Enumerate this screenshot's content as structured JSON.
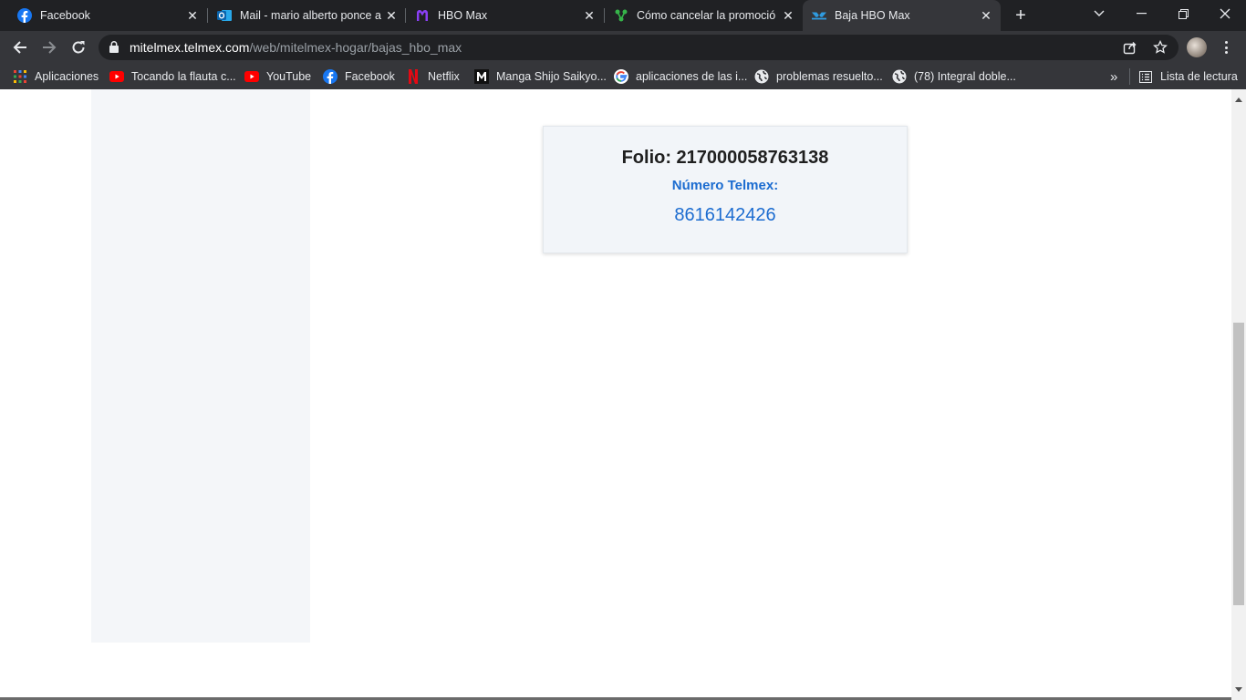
{
  "browser": {
    "tabs": [
      {
        "title": "Facebook",
        "icon": "facebook-icon"
      },
      {
        "title": "Mail - mario alberto ponce a",
        "icon": "outlook-icon"
      },
      {
        "title": "HBO Max",
        "icon": "hbomax-icon"
      },
      {
        "title": "Cómo cancelar la promoción",
        "icon": "green-logo-icon"
      },
      {
        "title": "Baja HBO Max",
        "icon": "telmex-icon",
        "active": true
      }
    ],
    "new_tab_label": "+",
    "address": {
      "host": "mitelmex.telmex.com",
      "path": "/web/mitelmex-hogar/bajas_hbo_max"
    },
    "bookmarks": [
      {
        "label": "Aplicaciones",
        "icon": "apps-grid-icon"
      },
      {
        "label": "Tocando la flauta c...",
        "icon": "youtube-icon"
      },
      {
        "label": "YouTube",
        "icon": "youtube-icon"
      },
      {
        "label": "Facebook",
        "icon": "facebook-icon"
      },
      {
        "label": "Netflix",
        "icon": "netflix-icon"
      },
      {
        "label": "Manga Shijo Saikyo...",
        "icon": "manga-icon"
      },
      {
        "label": "aplicaciones de las i...",
        "icon": "google-icon"
      },
      {
        "label": "problemas resuelto...",
        "icon": "globe-icon"
      },
      {
        "label": "(78) Integral doble...",
        "icon": "globe-icon"
      }
    ],
    "overflow_label": "»",
    "reading_list_label": "Lista de lectura"
  },
  "page": {
    "folio": "Folio: 217000058763138",
    "numero_label": "Número Telmex:",
    "numero_value": "8616142426"
  },
  "colors": {
    "accent_blue": "#1c6cd0",
    "browser_dark": "#202124",
    "browser_toolbar": "#35363a"
  }
}
